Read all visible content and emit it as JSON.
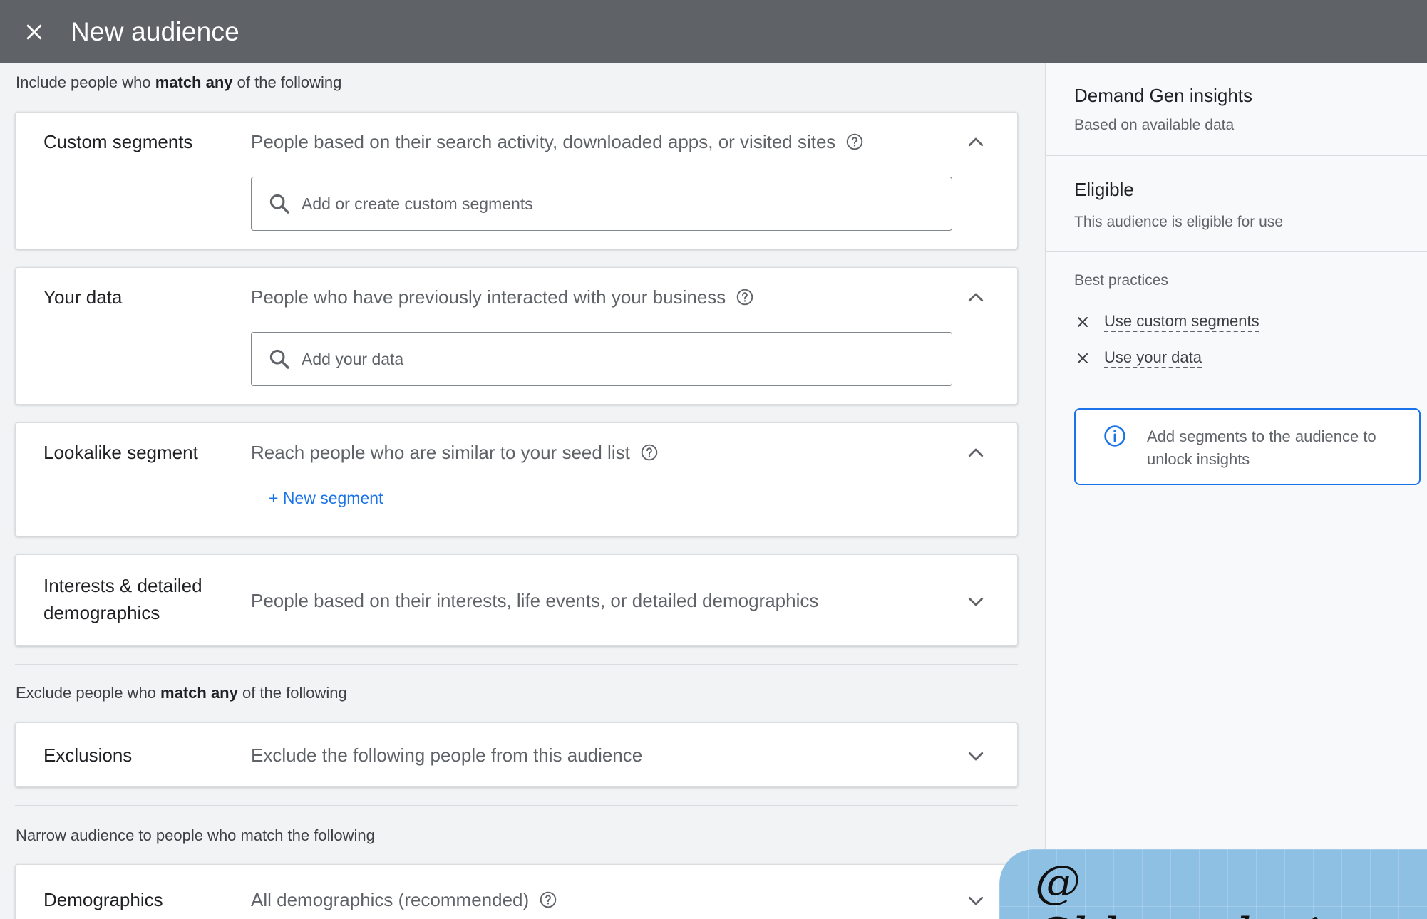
{
  "topbar": {
    "title": "New audience",
    "close_icon": "close-icon"
  },
  "include": {
    "label_prefix": "Include people who ",
    "label_bold": "match any",
    "label_suffix": " of the following"
  },
  "cards": {
    "custom_segments": {
      "title": "Custom segments",
      "description": "People based on their search activity, downloaded apps, or visited sites",
      "search_placeholder": "Add or create custom segments",
      "expanded": true
    },
    "your_data": {
      "title": "Your data",
      "description": "People who have previously interacted with your business",
      "search_placeholder": "Add your data",
      "expanded": true
    },
    "lookalike": {
      "title": "Lookalike segment",
      "description": "Reach people who are similar to your seed list",
      "new_segment_label": "+ New segment",
      "expanded": true
    },
    "interests": {
      "title_line1": "Interests & detailed",
      "title_line2": "demographics",
      "description": "People based on their interests, life events, or detailed demographics",
      "expanded": false
    },
    "exclusions": {
      "title": "Exclusions",
      "description": "Exclude the following people from this audience",
      "expanded": false
    },
    "demographics": {
      "title": "Demographics",
      "description": "All demographics (recommended)",
      "expanded": false
    }
  },
  "exclude": {
    "label_prefix": "Exclude people who ",
    "label_bold": "match any",
    "label_suffix": " of the following"
  },
  "narrow": {
    "label": "Narrow audience to people who match the following"
  },
  "side_panel": {
    "insights_title": "Demand Gen insights",
    "insights_sub": "Based on available data",
    "eligible_title": "Eligible",
    "eligible_sub": "This audience is eligible for use",
    "best_practices_label": "Best practices",
    "best_practices": [
      {
        "label": "Use custom segments",
        "status_icon": "x-icon"
      },
      {
        "label": "Use your data",
        "status_icon": "x-icon"
      }
    ],
    "info_text": "Add segments to the audience to unlock insights"
  },
  "watermark": {
    "text": "@ Chloevolution"
  },
  "colors": {
    "topbar": "#5f6368",
    "accent": "#1a73e8",
    "background": "#f1f3f4"
  }
}
